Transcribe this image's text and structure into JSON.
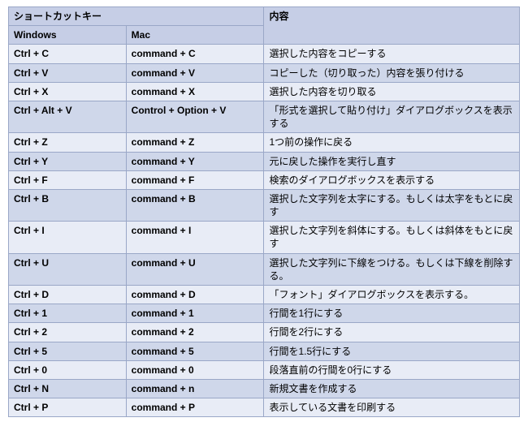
{
  "headers": {
    "shortcut": "ショートカットキー",
    "description": "内容",
    "windows": "Windows",
    "mac": "Mac"
  },
  "rows": [
    {
      "win": "Ctrl + C",
      "mac": "command + C",
      "desc": "選択した内容をコピーする"
    },
    {
      "win": "Ctrl + V",
      "mac": "command + V",
      "desc": "コピーした（切り取った）内容を張り付ける"
    },
    {
      "win": "Ctrl + X",
      "mac": "command + X",
      "desc": "選択した内容を切り取る"
    },
    {
      "win": "Ctrl + Alt + V",
      "mac": "Control + Option + V",
      "desc": "「形式を選択して貼り付け」ダイアログボックスを表示する"
    },
    {
      "win": "Ctrl + Z",
      "mac": "command + Z",
      "desc": "1つ前の操作に戻る"
    },
    {
      "win": "Ctrl + Y",
      "mac": "command + Y",
      "desc": "元に戻した操作を実行し直す"
    },
    {
      "win": "Ctrl + F",
      "mac": "command + F",
      "desc": "検索のダイアログボックスを表示する"
    },
    {
      "win": "Ctrl + B",
      "mac": "command + B",
      "desc": "選択した文字列を太字にする。もしくは太字をもとに戻す"
    },
    {
      "win": "Ctrl + I",
      "mac": "command + I",
      "desc": "選択した文字列を斜体にする。もしくは斜体をもとに戻す"
    },
    {
      "win": "Ctrl + U",
      "mac": "command + U",
      "desc": "選択した文字列に下線をつける。もしくは下線を削除する。"
    },
    {
      "win": "Ctrl + D",
      "mac": "command + D",
      "desc": "「フォント」ダイアログボックスを表示する。"
    },
    {
      "win": "Ctrl + 1",
      "mac": "command + 1",
      "desc": "行間を1行にする"
    },
    {
      "win": "Ctrl + 2",
      "mac": "command + 2",
      "desc": "行間を2行にする"
    },
    {
      "win": "Ctrl + 5",
      "mac": "command + 5",
      "desc": "行間を1.5行にする"
    },
    {
      "win": "Ctrl + 0",
      "mac": "command + 0",
      "desc": "段落直前の行間を0行にする"
    },
    {
      "win": "Ctrl + N",
      "mac": "command + n",
      "desc": "新規文書を作成する"
    },
    {
      "win": "Ctrl + P",
      "mac": "command + P",
      "desc": "表示している文書を印刷する"
    }
  ]
}
